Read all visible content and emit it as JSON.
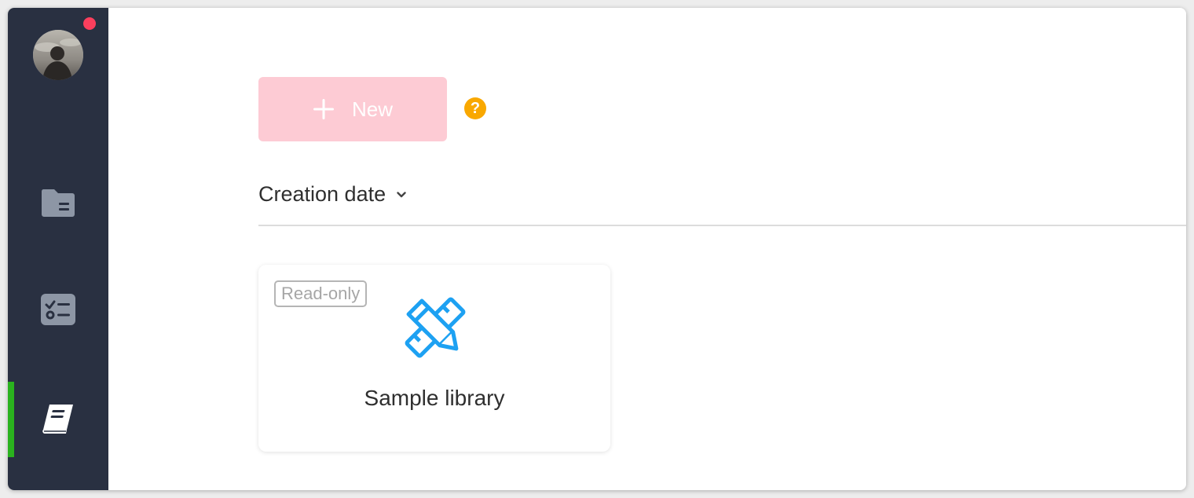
{
  "sidebar": {
    "nav_items": [
      {
        "icon": "folder-icon",
        "active": false
      },
      {
        "icon": "checklist-icon",
        "active": false
      },
      {
        "icon": "book-icon",
        "active": true
      }
    ],
    "notification_dot": true,
    "active_indicator_color": "#2ab21e"
  },
  "toolbar": {
    "new_label": "New",
    "new_button_color": "#fdcbd4",
    "help_symbol": "?",
    "help_color": "#f9a800"
  },
  "sort": {
    "label": "Creation date"
  },
  "cards": [
    {
      "badge": "Read-only",
      "icon": "pencil-ruler-icon",
      "icon_color": "#1da1f2",
      "title": "Sample library"
    }
  ],
  "colors": {
    "sidebar_bg": "#293041",
    "sidebar_icon": "#8d96a5",
    "notification": "#fb3f5d"
  }
}
